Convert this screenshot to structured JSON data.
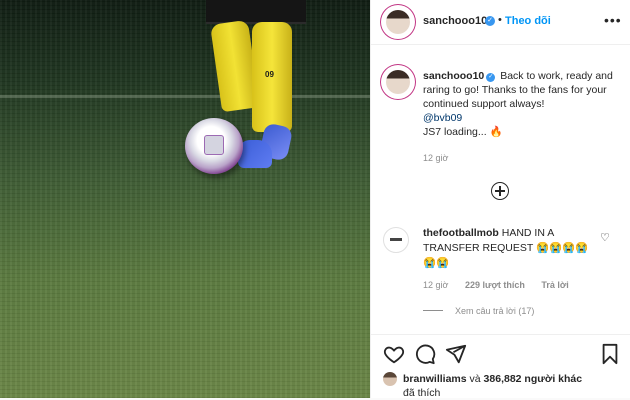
{
  "post_author": {
    "username": "sanchooo10",
    "follow_label": "Theo dõi",
    "separator": "•"
  },
  "photo": {
    "sock_number": "09"
  },
  "caption": {
    "username": "sanchooo10",
    "text_line1": "Back to work, ready and raring to go! Thanks to the fans for your continued support always!",
    "mention": "@bvb09",
    "text_line2": "JS7 loading...",
    "emoji": "🔥",
    "time": "12 giờ"
  },
  "comment": {
    "username": "thefootballmob",
    "text": "HAND IN A TRANSFER REQUEST 😭😭😭😭 😭😭",
    "time": "12 giờ",
    "likes": "229 lượt thích",
    "reply_label": "Trả lời",
    "view_replies": "Xem câu trả lời (17)"
  },
  "likes": {
    "user": "branwilliams",
    "conj": "và",
    "others": "386,882 người khác",
    "suffix": "đã thích"
  },
  "icons": [
    "verified-badge-icon",
    "more-options-icon",
    "add-comment-icon",
    "heart-icon",
    "comment-icon",
    "share-icon",
    "bookmark-icon"
  ],
  "colors": {
    "accent_blue": "#0095f6",
    "verified_blue": "#3897f0",
    "meta_grey": "#8e8e8e"
  }
}
